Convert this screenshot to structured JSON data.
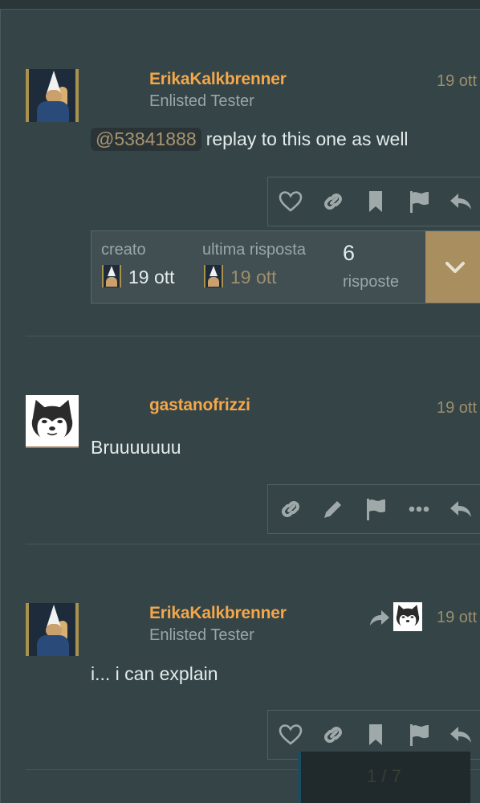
{
  "posts": [
    {
      "username": "ErikaKalkbrenner",
      "user_title": "Enlisted Tester",
      "date": "19 ott",
      "mention": "@53841888",
      "text": "replay to this one as well",
      "avatar_icon": "tester-avatar"
    },
    {
      "username": "gastanofrizzi",
      "date": "19 ott",
      "text": "Bruuuuuuu",
      "avatar_icon": "dog-avatar"
    },
    {
      "username": "ErikaKalkbrenner",
      "user_title": "Enlisted Tester",
      "date": "19 ott",
      "text": "i... i can explain",
      "avatar_icon": "tester-avatar"
    }
  ],
  "topic_summary": {
    "created_label": "creato",
    "created_date": "19 ott",
    "last_reply_label": "ultima risposta",
    "last_reply_date": "19 ott",
    "replies_count": "6",
    "replies_label": "risposte"
  },
  "scroller": {
    "position": "1 / 7"
  },
  "colors": {
    "background": "#344447",
    "username": "#f4a74a",
    "date": "#9c8f6c",
    "accent": "#a98e5f"
  }
}
